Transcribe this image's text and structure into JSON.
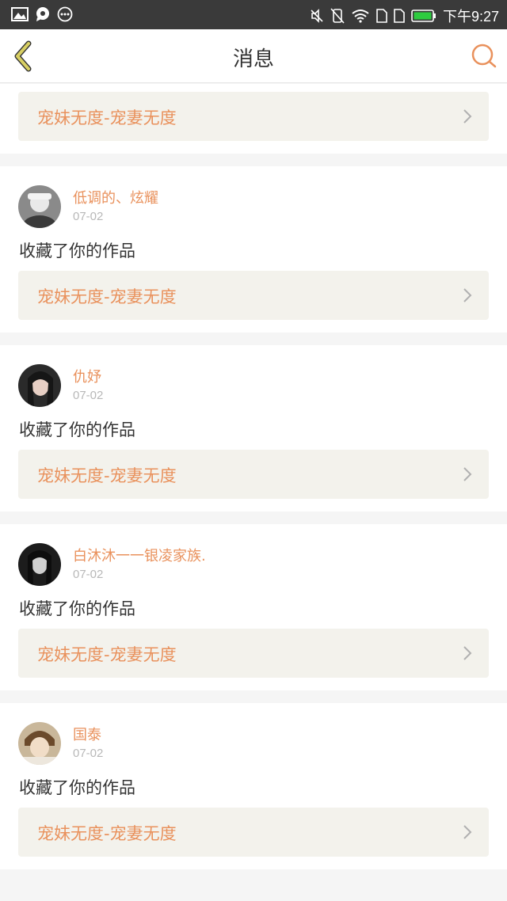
{
  "status_bar": {
    "time": "下午9:27",
    "left_icons": [
      "image-icon",
      "chat-bubble-icon",
      "more-dots-icon"
    ],
    "right_icons": [
      "mute-icon",
      "vibrate-off-icon",
      "wifi-icon",
      "sim1-icon",
      "sim2-icon",
      "battery-icon"
    ]
  },
  "header": {
    "title": "消息",
    "back_icon": "chevron-left-icon",
    "search_icon": "search-icon"
  },
  "colors": {
    "accent": "#e9915c",
    "back_icon": "#c9c15a",
    "card_bg": "#f3f2ec",
    "page_bg": "#f5f5f5"
  },
  "partial_first": {
    "work_title": "宠妹无度-宠妻无度"
  },
  "messages": [
    {
      "name": "低调的、炫耀",
      "date": "07-02",
      "action": "收藏了你的作品",
      "work_title": "宠妹无度-宠妻无度"
    },
    {
      "name": "仇妤",
      "date": "07-02",
      "action": "收藏了你的作品",
      "work_title": "宠妹无度-宠妻无度"
    },
    {
      "name": "白沐沐一一银凌家族.",
      "date": "07-02",
      "action": "收藏了你的作品",
      "work_title": "宠妹无度-宠妻无度"
    },
    {
      "name": "国泰",
      "date": "07-02",
      "action": "收藏了你的作品",
      "work_title": "宠妹无度-宠妻无度"
    }
  ]
}
